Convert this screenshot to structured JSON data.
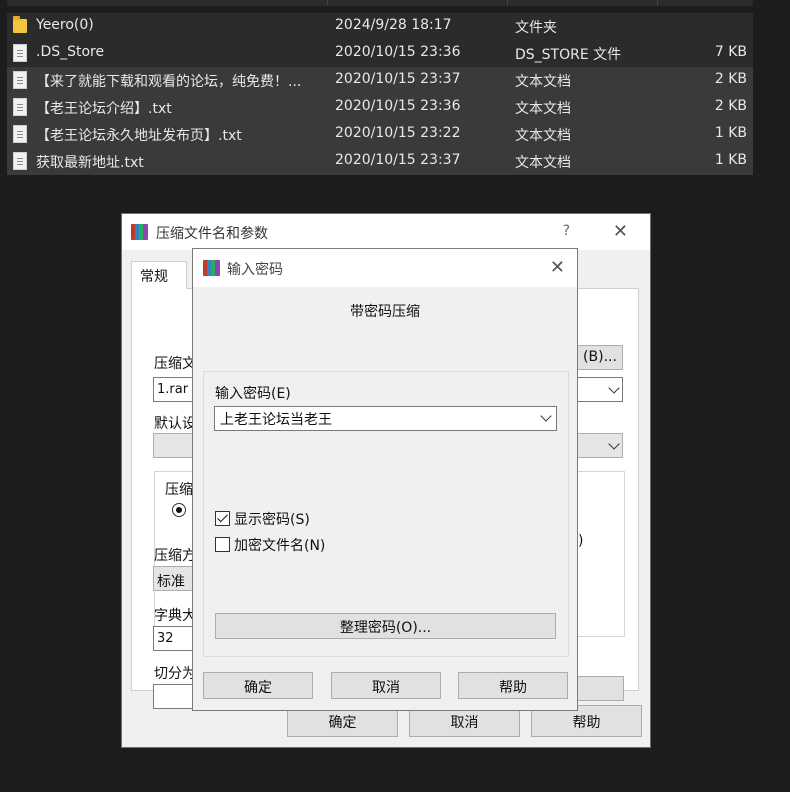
{
  "files": [
    {
      "icon": "folder-icon",
      "name": "Yeero(0)",
      "date": "2024/9/28 18:17",
      "type": "文件夹",
      "size": ""
    },
    {
      "icon": "file-icon",
      "name": ".DS_Store",
      "date": "2020/10/15 23:36",
      "type": "DS_STORE 文件",
      "size": "7 KB"
    },
    {
      "icon": "text-file-icon",
      "name": "【来了就能下载和观看的论坛，纯免费！...",
      "date": "2020/10/15 23:37",
      "type": "文本文档",
      "size": "2 KB"
    },
    {
      "icon": "text-file-icon",
      "name": "【老王论坛介绍】.txt",
      "date": "2020/10/15 23:36",
      "type": "文本文档",
      "size": "2 KB"
    },
    {
      "icon": "text-file-icon",
      "name": "【老王论坛永久地址发布页】.txt",
      "date": "2020/10/15 23:22",
      "type": "文本文档",
      "size": "1 KB"
    },
    {
      "icon": "text-file-icon",
      "name": "获取最新地址.txt",
      "date": "2020/10/15 23:37",
      "type": "文本文档",
      "size": "1 KB"
    }
  ],
  "archive_dialog": {
    "title": "压缩文件名和参数",
    "help_glyph": "?",
    "close_glyph": "✕",
    "tab_general": "常规",
    "label_archive_name": "压缩文",
    "archive_name_value": "1.rar",
    "browse_button": "(B)...",
    "label_default": "默认设",
    "label_format": "压缩",
    "label_method": "压缩方",
    "method_value": "标准",
    "label_dict": "字典大",
    "dict_value": "32",
    "label_split": "切分为",
    "radio_right_fragment": ")",
    "ok_button": "确定",
    "cancel_button": "取消",
    "help_button": "帮助"
  },
  "password_dialog": {
    "title": "输入密码",
    "close_glyph": "✕",
    "heading": "带密码压缩",
    "password_label": "输入密码(E)",
    "password_value": "上老王论坛当老王",
    "show_password_label": "显示密码(S)",
    "show_password_checked": true,
    "encrypt_names_label": "加密文件名(N)",
    "encrypt_names_checked": false,
    "organize_button": "整理密码(O)...",
    "ok_button": "确定",
    "cancel_button": "取消",
    "help_button": "帮助"
  },
  "colors": {
    "app_icon": [
      "#c0392b",
      "#2e86c1",
      "#27ae60",
      "#8e44ad"
    ]
  }
}
